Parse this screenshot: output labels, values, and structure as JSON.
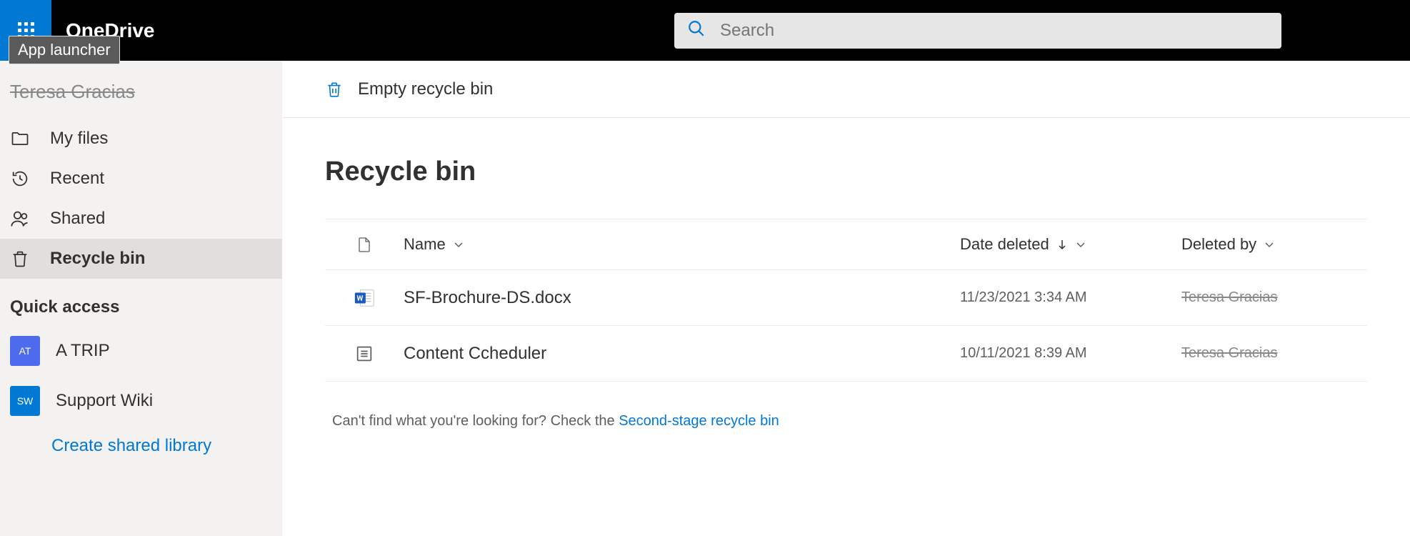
{
  "header": {
    "app_title": "OneDrive",
    "tooltip": "App launcher",
    "search_placeholder": "Search"
  },
  "sidebar": {
    "user_name": "Teresa Gracias",
    "nav_items": [
      {
        "label": "My files",
        "icon": "folder-icon"
      },
      {
        "label": "Recent",
        "icon": "clock-icon"
      },
      {
        "label": "Shared",
        "icon": "people-icon"
      },
      {
        "label": "Recycle bin",
        "icon": "trash-icon"
      }
    ],
    "quick_access_label": "Quick access",
    "quick_access": [
      {
        "label": "A TRIP",
        "badge": "AT",
        "color": "#4f6bed"
      },
      {
        "label": "Support Wiki",
        "badge": "SW",
        "color": "#0078d4"
      }
    ],
    "create_library": "Create shared library"
  },
  "toolbar": {
    "empty_bin": "Empty recycle bin"
  },
  "main": {
    "title": "Recycle bin",
    "columns": {
      "name": "Name",
      "date_deleted": "Date deleted",
      "deleted_by": "Deleted by"
    },
    "rows": [
      {
        "name": "SF-Brochure-DS.docx",
        "date": "11/23/2021 3:34 AM",
        "deleted_by": "Teresa Gracias",
        "type": "word"
      },
      {
        "name": "Content Ccheduler",
        "date": "10/11/2021 8:39 AM",
        "deleted_by": "Teresa Gracias",
        "type": "list"
      }
    ],
    "footer_prefix": "Can't find what you're looking for? Check the ",
    "footer_link": "Second-stage recycle bin"
  }
}
